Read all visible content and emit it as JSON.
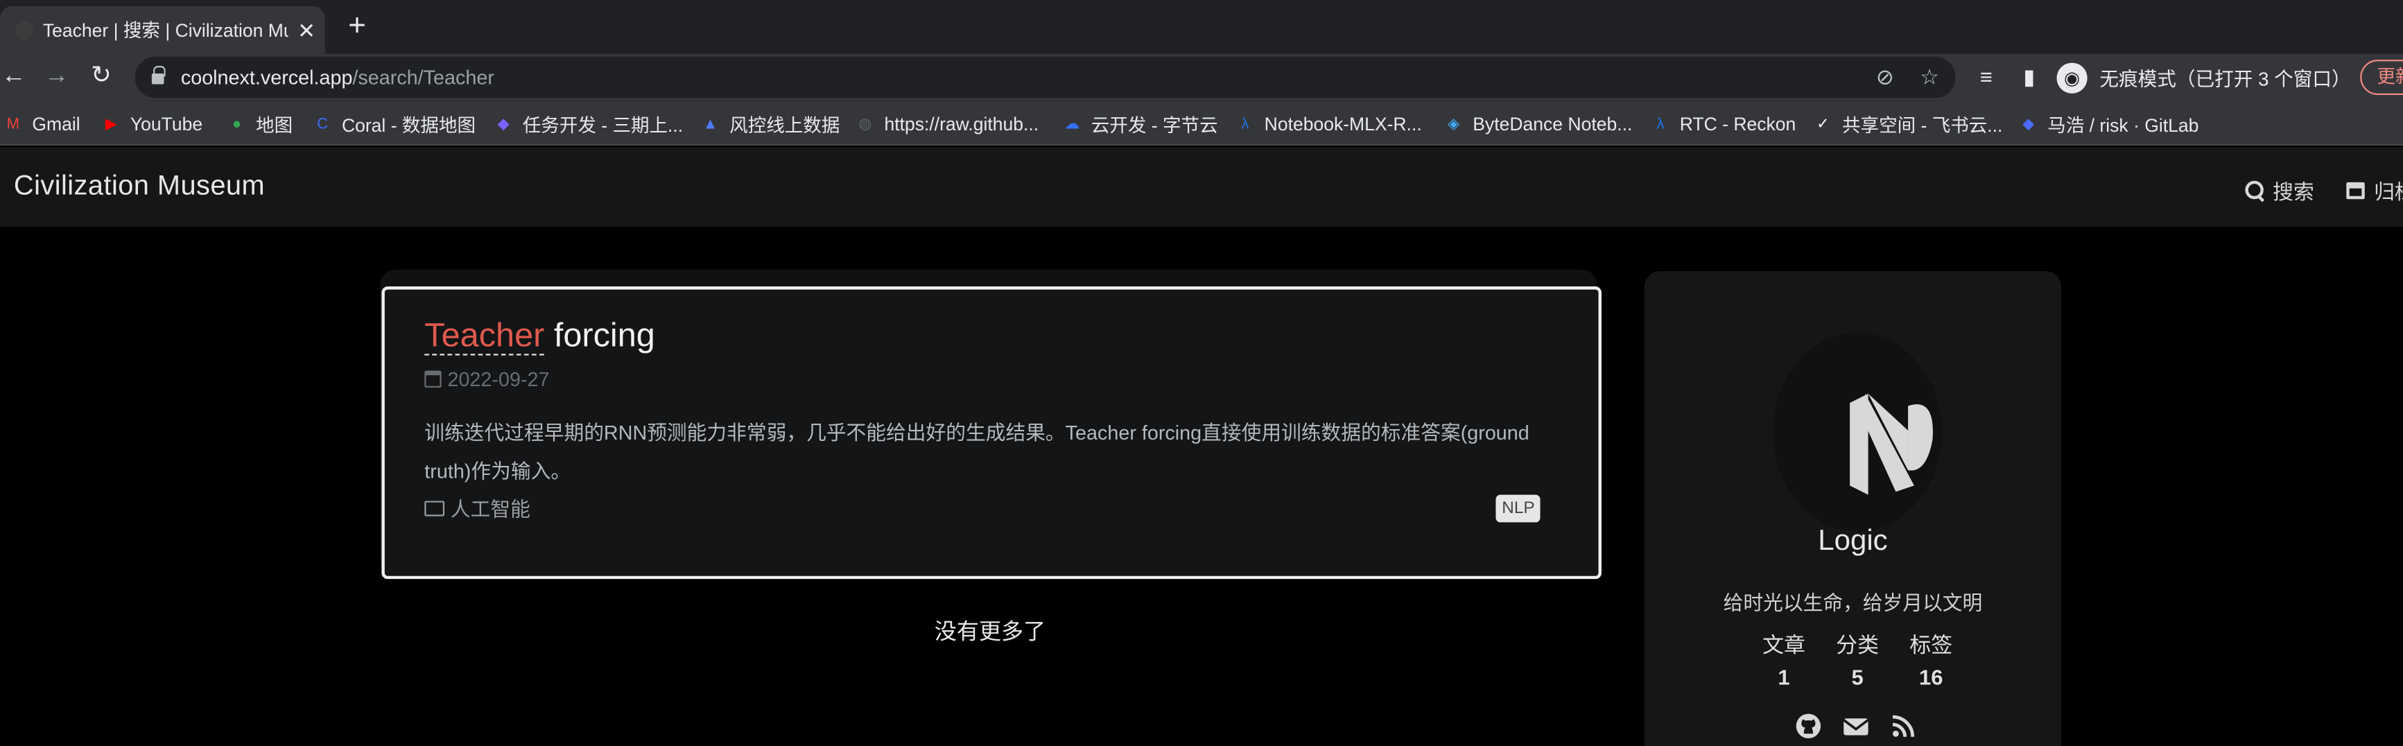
{
  "browser": {
    "tab_title": "Teacher | 搜索 | Civilization Museum",
    "tab_close": "✕",
    "new_tab": "+",
    "url_host": "coolnext.vercel.app",
    "url_path": "/search/Teacher",
    "profile_label": "无痕模式（已打开 3 个窗口）",
    "update_label": "更新"
  },
  "bookmarks": [
    {
      "label": "Gmail",
      "icon": "gmail-icon",
      "color": "#ea4335",
      "glyph": "M"
    },
    {
      "label": "YouTube",
      "icon": "youtube-icon",
      "color": "#ff0000",
      "glyph": "▶"
    },
    {
      "label": "地图",
      "icon": "maps-icon",
      "color": "#34a853",
      "glyph": "●"
    },
    {
      "label": "Coral - 数据地图",
      "icon": "coral-icon",
      "color": "#3b6cf6",
      "glyph": "C"
    },
    {
      "label": "任务开发 - 三期上...",
      "icon": "task-icon",
      "color": "#7b61ff",
      "glyph": "◆"
    },
    {
      "label": "风控线上数据",
      "icon": "risk-icon",
      "color": "#4d7cff",
      "glyph": "▲"
    },
    {
      "label": "https://raw.github...",
      "icon": "globe-icon",
      "color": "#5f6368",
      "glyph": "◍"
    },
    {
      "label": "云开发 - 字节云",
      "icon": "cloud-icon",
      "color": "#3370ff",
      "glyph": "☁"
    },
    {
      "label": "Notebook-MLX-R...",
      "icon": "lambda-icon",
      "color": "#1a73e8",
      "glyph": "λ"
    },
    {
      "label": "ByteDance Noteb...",
      "icon": "layers-icon",
      "color": "#3fa9f5",
      "glyph": "◈"
    },
    {
      "label": "RTC - Reckon",
      "icon": "lambda-icon",
      "color": "#1a73e8",
      "glyph": "λ"
    },
    {
      "label": "共享空间 - 飞书云...",
      "icon": "feishu-icon",
      "color": "#ffffff",
      "glyph": "✓"
    },
    {
      "label": "马浩 / risk · GitLab",
      "icon": "gitlab-icon",
      "color": "#4a6cf7",
      "glyph": "◆"
    }
  ],
  "site": {
    "title": "Civilization Museum",
    "nav_search": "搜索",
    "nav_archive": "归档"
  },
  "post": {
    "title_highlight": "Teacher",
    "title_rest": " forcing",
    "date": "2022-09-27",
    "excerpt": "训练迭代过程早期的RNN预测能力非常弱，几乎不能给出好的生成结果。Teacher forcing直接使用训练数据的标准答案(ground truth)作为输入。",
    "category": "人工智能",
    "tag": "NLP"
  },
  "no_more": "没有更多了",
  "sidebar": {
    "author": "Logic",
    "motto": "给时光以生命，给岁月以文明",
    "stats": [
      {
        "label": "文章",
        "value": "1"
      },
      {
        "label": "分类",
        "value": "5"
      },
      {
        "label": "标签",
        "value": "16"
      }
    ]
  },
  "colors": {
    "highlight": "#e05a4f",
    "page_bg": "#000000",
    "card_bg": "#141516"
  }
}
